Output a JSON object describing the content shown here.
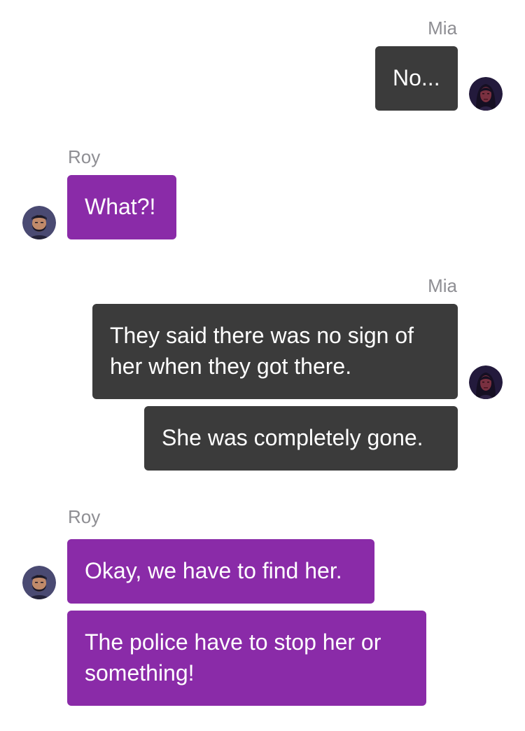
{
  "conversation": {
    "groups": [
      {
        "sender": "Mia",
        "messages": [
          "No..."
        ]
      },
      {
        "sender": "Roy",
        "messages": [
          "What?!"
        ]
      },
      {
        "sender": "Mia",
        "messages": [
          "They said there was no sign of her when they got there.",
          "She was completely gone."
        ]
      },
      {
        "sender": "Roy",
        "messages": [
          "Okay, we have to find her.",
          "The police have to stop her or something!"
        ]
      }
    ]
  },
  "colors": {
    "mia_bubble": "#3b3b3b",
    "roy_bubble": "#8a2ba8",
    "sender_label": "#8e8e93",
    "message_text": "#ffffff"
  },
  "icons": {
    "mia_avatar": "woman-portrait-avatar",
    "roy_avatar": "bearded-man-portrait-avatar"
  }
}
